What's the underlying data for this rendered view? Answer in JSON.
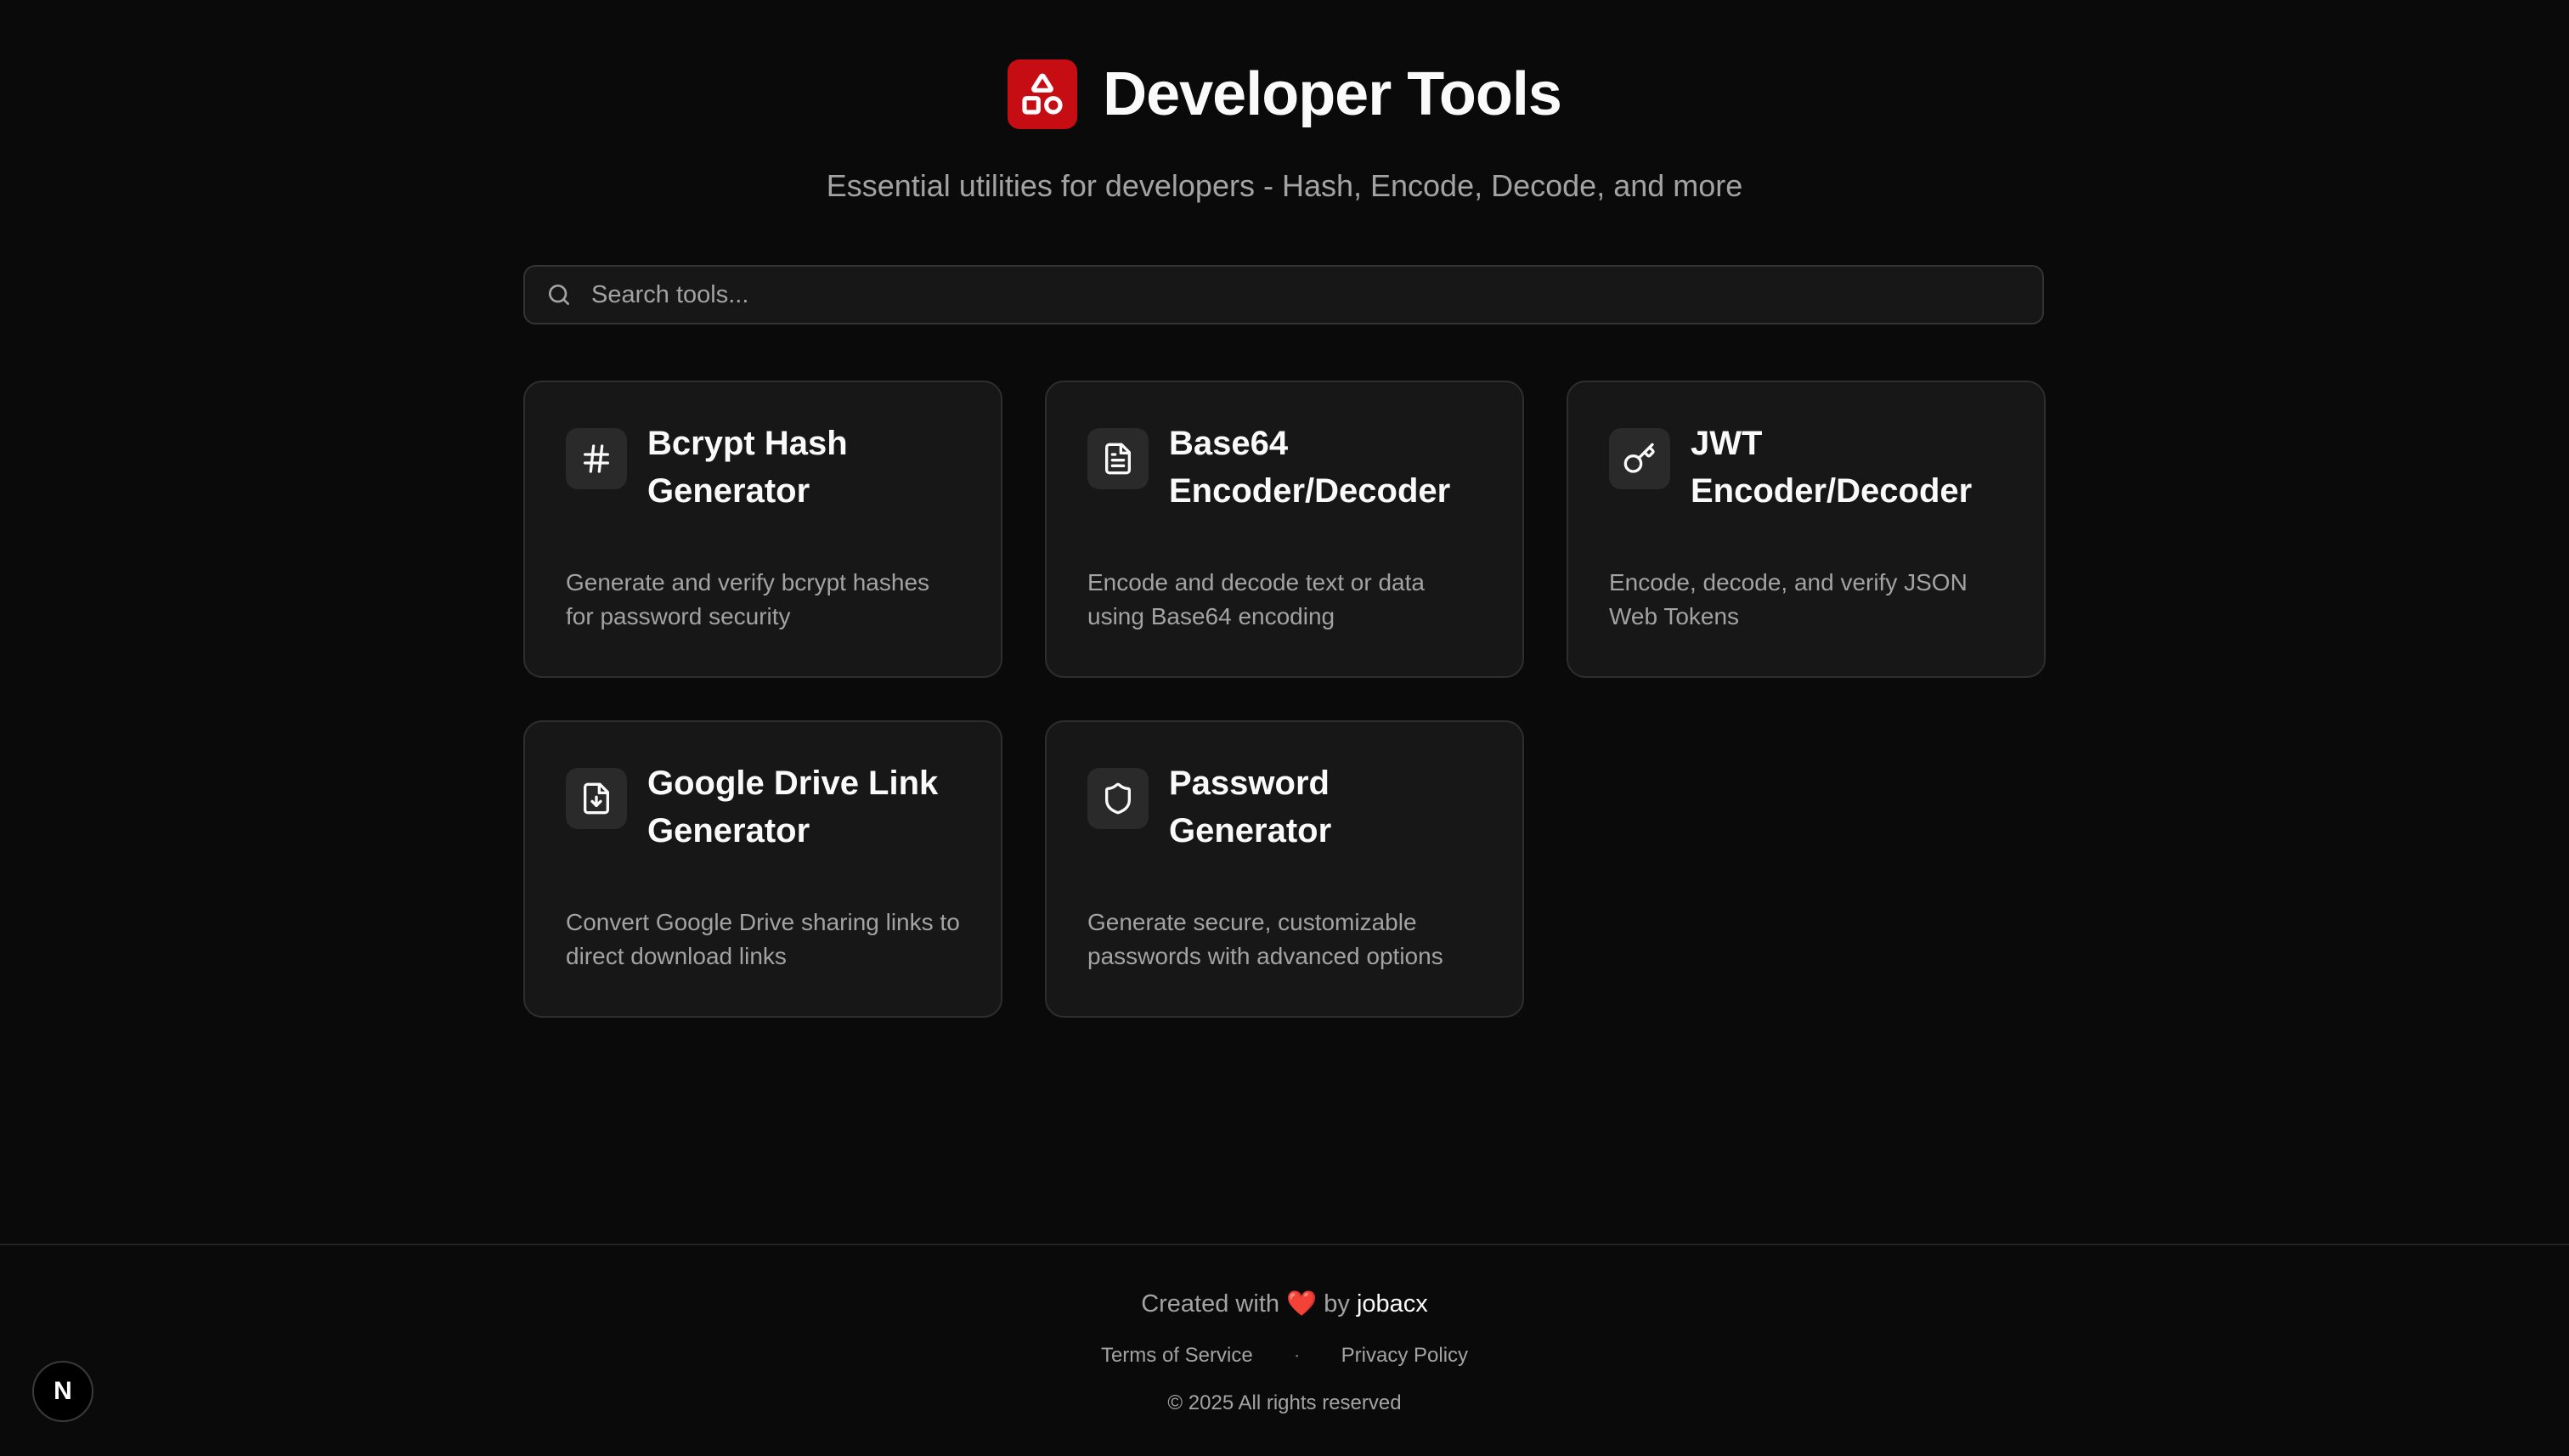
{
  "header": {
    "title": "Developer Tools",
    "subtitle": "Essential utilities for developers - Hash, Encode, Decode, and more",
    "logo_color": "#c70d14"
  },
  "search": {
    "placeholder": "Search tools...",
    "value": ""
  },
  "tools": [
    {
      "title": "Bcrypt Hash Generator",
      "description": "Generate and verify bcrypt hashes for password security",
      "icon": "hash-icon"
    },
    {
      "title": "Base64 Encoder/Decoder",
      "description": "Encode and decode text or data using Base64 encoding",
      "icon": "file-text-icon"
    },
    {
      "title": "JWT Encoder/Decoder",
      "description": "Encode, decode, and verify JSON Web Tokens",
      "icon": "key-icon"
    },
    {
      "title": "Google Drive Link Generator",
      "description": "Convert Google Drive sharing links to direct download links",
      "icon": "file-download-icon"
    },
    {
      "title": "Password Generator",
      "description": "Generate secure, customizable passwords with advanced options",
      "icon": "shield-icon"
    }
  ],
  "footer": {
    "created_prefix": "Created with",
    "created_heart": "❤️",
    "created_by": "by",
    "author": "jobacx",
    "terms_label": "Terms of Service",
    "separator": "·",
    "privacy_label": "Privacy Policy",
    "copyright": "© 2025 All rights reserved"
  },
  "badge": {
    "label": "N"
  }
}
